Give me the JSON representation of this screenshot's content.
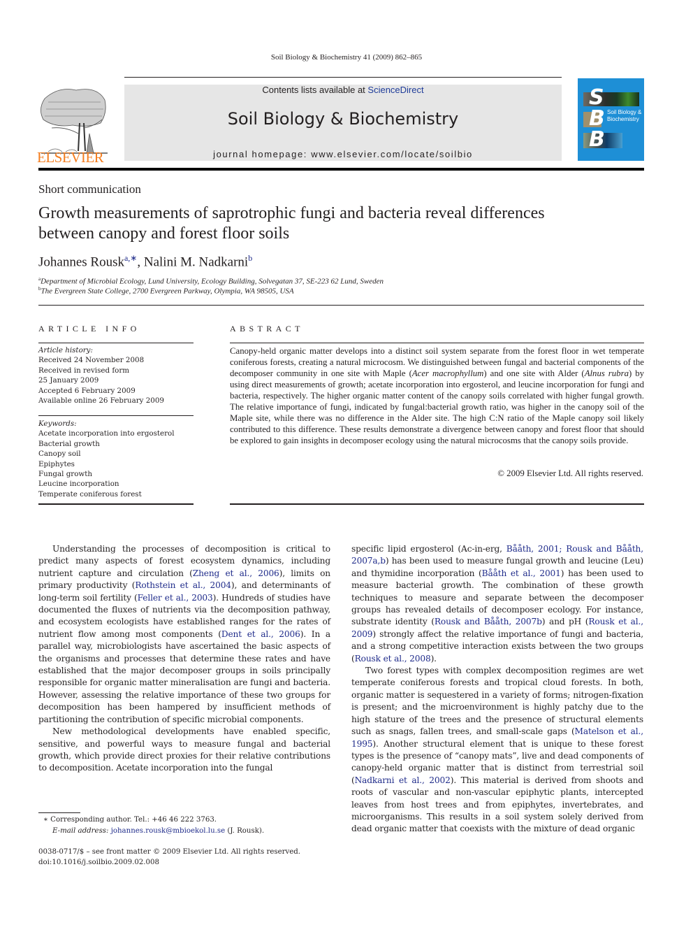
{
  "running_head": "Soil Biology & Biochemistry 41 (2009) 862–865",
  "banner": {
    "contents_prefix": "Contents lists available at ",
    "contents_link": "ScienceDirect",
    "journal_title": "Soil Biology & Biochemistry",
    "homepage": "journal homepage: www.elsevier.com/locate/soilbio"
  },
  "publisher_logo": {
    "wordmark": "ELSEVIER",
    "icon": "elsevier-tree-icon",
    "color": "#f47e20"
  },
  "cover": {
    "letters": [
      "S",
      "B",
      "B"
    ],
    "title_line1": "Soil Biology &",
    "title_line2": "Biochemistry",
    "color": "#1e8fd6"
  },
  "article": {
    "type": "Short communication",
    "title_line1": "Growth measurements of saprotrophic fungi and bacteria reveal differences",
    "title_line2": "between canopy and forest floor soils",
    "authors": [
      {
        "name": "Johannes Rousk",
        "sup": "a,∗"
      },
      {
        "name": ", Nalini M. Nadkarni",
        "sup": "b"
      }
    ],
    "affiliations": [
      {
        "sup": "a",
        "text": "Department of Microbial Ecology, Lund University, Ecology Building, Solvegatan 37, SE-223 62 Lund, Sweden"
      },
      {
        "sup": "b",
        "text": "The Evergreen State College, 2700 Evergreen Parkway, Olympia, WA 98505, USA"
      }
    ]
  },
  "article_info": {
    "label": "ARTICLE INFO",
    "history_label": "Article history:",
    "history": [
      "Received 24 November 2008",
      "Received in revised form",
      "25 January 2009",
      "Accepted 6 February 2009",
      "Available online 26 February 2009"
    ],
    "keywords_label": "Keywords:",
    "keywords": [
      "Acetate incorporation into ergosterol",
      "Bacterial growth",
      "Canopy soil",
      "Epiphytes",
      "Fungal growth",
      "Leucine incorporation",
      "Temperate coniferous forest"
    ]
  },
  "abstract": {
    "label": "ABSTRACT",
    "s1": "Canopy-held organic matter develops into a distinct soil system separate from the forest floor in wet temperate coniferous forests, creating a natural microcosm. We distinguished between fungal and bacterial components of the decomposer community in one site with Maple (",
    "i1": "Acer macrophyllum",
    "s2": ") and one site with Alder (",
    "i2": "Alnus rubra",
    "s3": ") by using direct measurements of growth; acetate incorporation into ergosterol, and leucine incorporation for fungi and bacteria, respectively. The higher organic matter content of the canopy soils correlated with higher fungal growth. The relative importance of fungi, indicated by fungal:bacterial growth ratio, was higher in the canopy soil of the Maple site, while there was no difference in the Alder site. The high C:N ratio of the Maple canopy soil likely contributed to this difference. These results demonstrate a divergence between canopy and forest floor that should be explored to gain insights in decomposer ecology using the natural microcosms that the canopy soils provide.",
    "copyright": "© 2009 Elsevier Ltd. All rights reserved."
  },
  "body": {
    "p1": [
      "Understanding the processes of decomposition is critical to predict many aspects of forest ecosystem dynamics, including nutrient capture and circulation (",
      "Zheng et al., 2006",
      "), limits on primary productivity (",
      "Rothstein et al., 2004",
      "), and determinants of long-term soil fertility (",
      "Feller et al., 2003",
      "). Hundreds of studies have documented the fluxes of nutrients via the decomposition pathway, and ecosystem ecologists have established ranges for the rates of nutrient flow among most components (",
      "Dent et al., 2006",
      "). In a parallel way, microbiologists have ascertained the basic aspects of the organisms and processes that determine these rates and have established that the major decomposer groups in soils principally responsible for organic matter mineralisation are fungi and bacteria. However, assessing the relative importance of these two groups for decomposition has been hampered by insufficient methods of partitioning the contribution of specific microbial components."
    ],
    "p2": "New methodological developments have enabled specific, sensitive, and powerful ways to measure fungal and bacterial growth, which provide direct proxies for their relative contributions to decomposition. Acetate incorporation into the fungal",
    "p3": [
      "specific lipid ergosterol (Ac-in-erg, ",
      "Bååth, 2001; Rousk and Bååth, 2007a,b",
      ") has been used to measure fungal growth and leucine (Leu) and thymidine incorporation (",
      "Bååth et al., 2001",
      ") has been used to measure bacterial growth. The combination of these growth techniques to measure and separate between the decomposer groups has revealed details of decomposer ecology. For instance, substrate identity (",
      "Rousk and Bååth, 2007b",
      ") and pH (",
      "Rousk et al., 2009",
      ") strongly affect the relative importance of fungi and bacteria, and a strong competitive interaction exists between the two groups (",
      "Rousk et al., 2008",
      ")."
    ],
    "p4": [
      "Two forest types with complex decomposition regimes are wet temperate coniferous forests and tropical cloud forests. In both, organic matter is sequestered in a variety of forms; nitrogen-fixation is present; and the microenvironment is highly patchy due to the high stature of the trees and the presence of structural elements such as snags, fallen trees, and small-scale gaps (",
      "Matelson et al., 1995",
      "). Another structural element that is unique to these forest types is the presence of “canopy mats”, live and dead components of canopy-held organic matter that is distinct from terrestrial soil (",
      "Nadkarni et al., 2002",
      "). This material is derived from shoots and roots of vascular and non-vascular epiphytic plants, intercepted leaves from host trees and from epiphytes, invertebrates, and microorganisms. This results in a soil system solely derived from dead organic matter that coexists with the mixture of dead organic"
    ]
  },
  "footnotes": {
    "corresponding": "∗  Corresponding author. Tel.: +46 46 222 3763.",
    "email_label": "E-mail address: ",
    "email": "johannes.rousk@mbioekol.lu.se",
    "email_suffix": " (J. Rousk).",
    "issn": "0038-0717/$ – see front matter © 2009 Elsevier Ltd. All rights reserved.",
    "doi": "doi:10.1016/j.soilbio.2009.02.008"
  }
}
